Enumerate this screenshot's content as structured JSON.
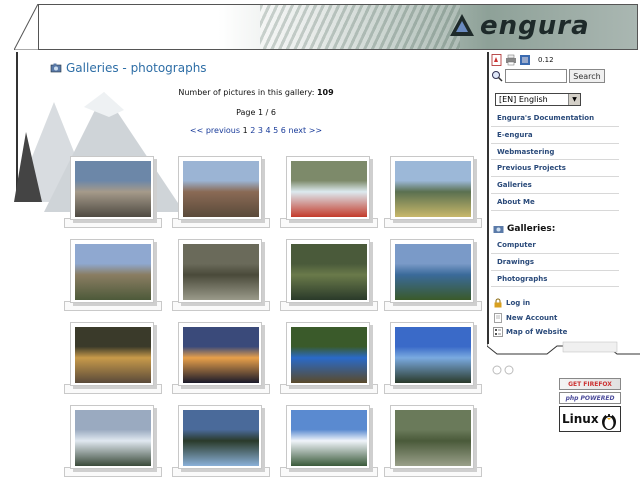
{
  "header": {
    "logo_text": "engura"
  },
  "gallery": {
    "title": "Galleries - photographs",
    "count_label": "Number of pictures in this gallery:",
    "count_value": "109",
    "page_label": "Page 1 / 6",
    "pager": {
      "prev": "<< previous",
      "pages": [
        "1",
        "2",
        "3",
        "4",
        "5",
        "6"
      ],
      "next": "next >>"
    },
    "thumbnails": [
      {
        "subject": "rocky summit",
        "colors": [
          "#6c87a8",
          "#a59a8a",
          "#4e4a42"
        ]
      },
      {
        "subject": "log cabin ridge",
        "colors": [
          "#9bb4d4",
          "#8a6a55",
          "#5a4a3a"
        ]
      },
      {
        "subject": "kayaker rapids",
        "colors": [
          "#7d8a6a",
          "#ddeaf0",
          "#c43a2a"
        ]
      },
      {
        "subject": "mountain lake",
        "colors": [
          "#9cb8d8",
          "#5a7050",
          "#c8b86a"
        ]
      },
      {
        "subject": "alpine valley",
        "colors": [
          "#8fa8d0",
          "#8a7d62",
          "#4d5a3a"
        ]
      },
      {
        "subject": "tree stump",
        "colors": [
          "#6a6a5a",
          "#4a4a3a",
          "#9a9a8a"
        ]
      },
      {
        "subject": "forest light",
        "colors": [
          "#4a5a3a",
          "#6a7a4a",
          "#2a3a2a"
        ]
      },
      {
        "subject": "lakeshore pines",
        "colors": [
          "#7a9ac8",
          "#3a6a9a",
          "#3a5a2a"
        ]
      },
      {
        "subject": "campfire night",
        "colors": [
          "#3a3a2a",
          "#c89a4a",
          "#5a4a3a"
        ]
      },
      {
        "subject": "sunset lake",
        "colors": [
          "#3a4a7a",
          "#e8a04a",
          "#1a1a2a"
        ]
      },
      {
        "subject": "tent forest",
        "colors": [
          "#3a5a2a",
          "#2a6ac8",
          "#5a4a2a"
        ]
      },
      {
        "subject": "blue lake trees",
        "colors": [
          "#3a6ac8",
          "#7aaae0",
          "#2a3a2a"
        ]
      },
      {
        "subject": "snowy forest",
        "colors": [
          "#9aaac0",
          "#e0e8f0",
          "#3a4a3a"
        ]
      },
      {
        "subject": "river pines",
        "colors": [
          "#4a6a9a",
          "#2a3a2a",
          "#8ab0d8"
        ]
      },
      {
        "subject": "snow peaks",
        "colors": [
          "#5a8ad0",
          "#f0f4fa",
          "#3a5a3a"
        ]
      },
      {
        "subject": "rock and trees",
        "colors": [
          "#6a7a5a",
          "#4a5a3a",
          "#9aa08a"
        ]
      }
    ]
  },
  "sidebar": {
    "version": "0.12",
    "search_button": "Search",
    "search_value": "",
    "language": "[EN] English",
    "menu": [
      "Engura's Documentation",
      "E-engura",
      "Webmastering",
      "Previous Projects",
      "Galleries",
      "About Me"
    ],
    "galleries_heading": "Galleries:",
    "galleries": [
      "Computer",
      "Drawings",
      "Photographs"
    ],
    "user_links": [
      "Log in",
      "New Account",
      "Map of Website"
    ]
  },
  "badges": {
    "firefox": "GET FIREFOX",
    "php": "php POWERED",
    "linux": "Linux"
  }
}
